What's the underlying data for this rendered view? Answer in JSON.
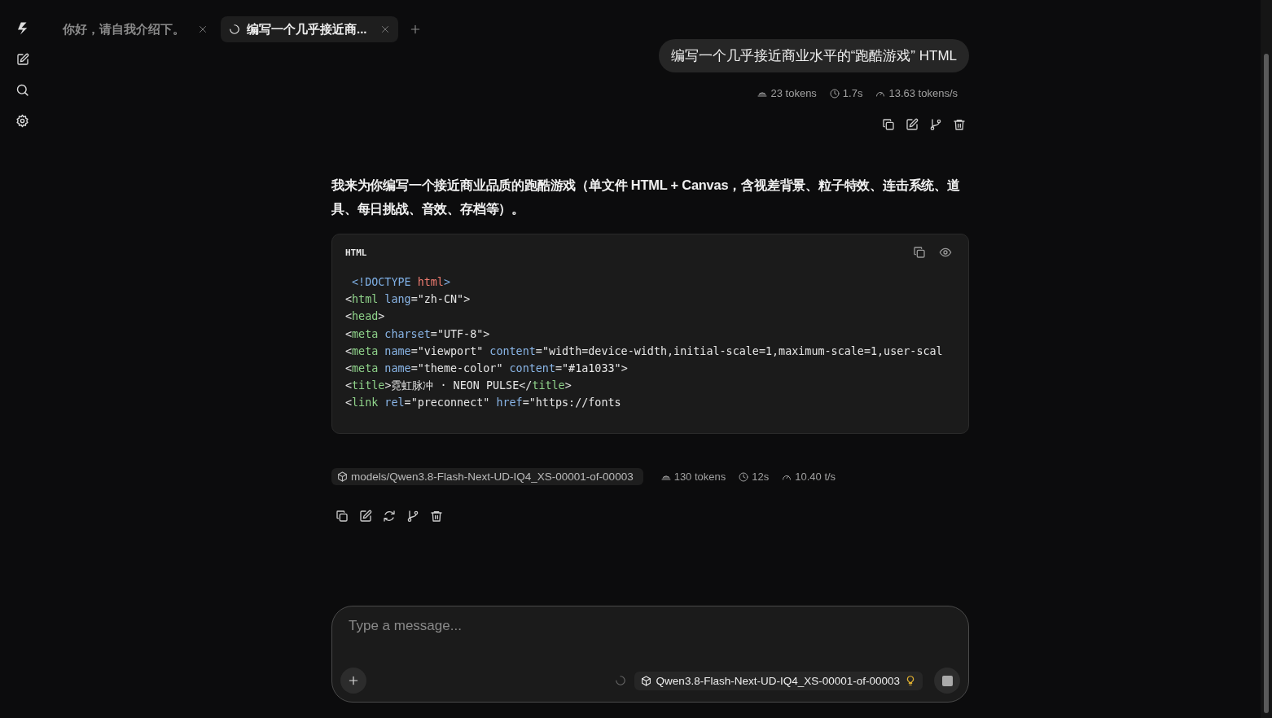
{
  "tabs": [
    {
      "label": "你好，请自我介绍下。",
      "selected": false,
      "loading": false
    },
    {
      "label": "编写一个几乎接近商...",
      "selected": true,
      "loading": true
    }
  ],
  "user_message": {
    "text": "编写一个几乎接近商业水平的“跑酷游戏” HTML",
    "stats": [
      {
        "kind": "tokens",
        "text": "23 tokens"
      },
      {
        "kind": "time",
        "text": "1.7s"
      },
      {
        "kind": "speed",
        "text": "13.63 tokens/s"
      }
    ]
  },
  "assistant_message": {
    "text": "我来为你编写一个接近商业品质的跑酷游戏（单文件 HTML + Canvas，含视差背景、粒子特效、连击系统、道具、每日挑战、音效、存档等）。",
    "code_block": {
      "language": "HTML",
      "lines": [
        [
          {
            "kind": "doctype",
            "text": " <!DOCTYPE"
          },
          {
            "kind": "kw",
            "text": " html"
          },
          {
            "kind": "doctype",
            "text": ">"
          }
        ],
        [
          {
            "kind": "punct",
            "text": "<"
          },
          {
            "kind": "tag",
            "text": "html"
          },
          {
            "kind": "attr",
            "text": " lang"
          },
          {
            "kind": "punct",
            "text": "="
          },
          {
            "kind": "str",
            "text": "\"zh-CN\""
          },
          {
            "kind": "punct",
            "text": ">"
          }
        ],
        [
          {
            "kind": "punct",
            "text": "<"
          },
          {
            "kind": "tag",
            "text": "head"
          },
          {
            "kind": "punct",
            "text": ">"
          }
        ],
        [
          {
            "kind": "punct",
            "text": "<"
          },
          {
            "kind": "tag",
            "text": "meta"
          },
          {
            "kind": "attr",
            "text": " charset"
          },
          {
            "kind": "punct",
            "text": "="
          },
          {
            "kind": "str",
            "text": "\"UTF-8\""
          },
          {
            "kind": "punct",
            "text": ">"
          }
        ],
        [
          {
            "kind": "punct",
            "text": "<"
          },
          {
            "kind": "tag",
            "text": "meta"
          },
          {
            "kind": "attr",
            "text": " name"
          },
          {
            "kind": "punct",
            "text": "="
          },
          {
            "kind": "str",
            "text": "\"viewport\""
          },
          {
            "kind": "attr",
            "text": " content"
          },
          {
            "kind": "punct",
            "text": "="
          },
          {
            "kind": "str",
            "text": "\"width=device-width,initial-scale=1,maximum-scale=1,user-scal"
          }
        ],
        [
          {
            "kind": "punct",
            "text": "<"
          },
          {
            "kind": "tag",
            "text": "meta"
          },
          {
            "kind": "attr",
            "text": " name"
          },
          {
            "kind": "punct",
            "text": "="
          },
          {
            "kind": "str",
            "text": "\"theme-color\""
          },
          {
            "kind": "attr",
            "text": " content"
          },
          {
            "kind": "punct",
            "text": "="
          },
          {
            "kind": "str",
            "text": "\"#1a1033\""
          },
          {
            "kind": "punct",
            "text": ">"
          }
        ],
        [
          {
            "kind": "punct",
            "text": "<"
          },
          {
            "kind": "tag",
            "text": "title"
          },
          {
            "kind": "punct",
            "text": ">霓虹脉冲 · NEON PULSE</"
          },
          {
            "kind": "tag",
            "text": "title"
          },
          {
            "kind": "punct",
            "text": ">"
          }
        ],
        [
          {
            "kind": "punct",
            "text": "<"
          },
          {
            "kind": "tag",
            "text": "link"
          },
          {
            "kind": "attr",
            "text": " rel"
          },
          {
            "kind": "punct",
            "text": "="
          },
          {
            "kind": "str",
            "text": "\"preconnect\""
          },
          {
            "kind": "attr",
            "text": " href"
          },
          {
            "kind": "punct",
            "text": "="
          },
          {
            "kind": "str",
            "text": "\"https://fonts"
          }
        ]
      ]
    },
    "model": "models/Qwen3.8-Flash-Next-UD-IQ4_XS-00001-of-00003",
    "stats": [
      {
        "kind": "tokens",
        "text": "130 tokens"
      },
      {
        "kind": "time",
        "text": "12s"
      },
      {
        "kind": "speed",
        "text": "10.40 t/s"
      }
    ]
  },
  "composer": {
    "placeholder": "Type a message...",
    "model": "Qwen3.8-Flash-Next-UD-IQ4_XS-00001-of-00003"
  }
}
